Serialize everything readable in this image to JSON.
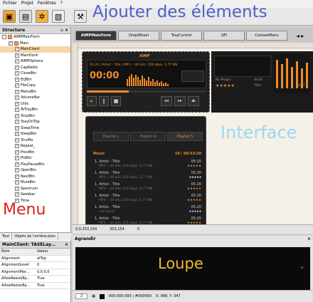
{
  "menubar": {
    "items": [
      "Fichier",
      "Projet",
      "Fenêtres",
      "?"
    ]
  },
  "overlay": {
    "title": "Ajouter des éléments",
    "interface": "Interface",
    "menu": "Menu",
    "loupe": "Loupe"
  },
  "structure": {
    "title": "Structure",
    "items": [
      {
        "label": "AIMPMainForm",
        "indent": 0,
        "checked": false,
        "icon": true
      },
      {
        "label": "Main",
        "indent": 1,
        "checked": true,
        "icon": true
      },
      {
        "label": "MainClient",
        "indent": 2,
        "checked": true,
        "selected": true
      },
      {
        "label": "MainDock",
        "indent": 2,
        "checked": true
      },
      {
        "label": "AIMPOptions",
        "indent": 2,
        "checked": true
      },
      {
        "label": "CapRadio",
        "indent": 2,
        "checked": true
      },
      {
        "label": "CloseBtn",
        "indent": 2,
        "checked": true
      },
      {
        "label": "EQBtn",
        "indent": 2,
        "checked": true
      },
      {
        "label": "FileCopy",
        "indent": 2,
        "checked": true
      },
      {
        "label": "MenuBtn",
        "indent": 2,
        "checked": true
      },
      {
        "label": "VolumeBar",
        "indent": 2,
        "checked": true
      },
      {
        "label": "Utils",
        "indent": 2,
        "checked": true
      },
      {
        "label": "ToTrayBtn",
        "indent": 2,
        "checked": true
      },
      {
        "label": "StopBtn",
        "indent": 2,
        "checked": true
      },
      {
        "label": "StayOnTop",
        "indent": 2,
        "checked": true
      },
      {
        "label": "SleepTime",
        "indent": 2,
        "checked": true
      },
      {
        "label": "SleepBtn",
        "indent": 2,
        "checked": true
      },
      {
        "label": "Shuffle",
        "indent": 2,
        "checked": true
      },
      {
        "label": "Repeat_",
        "indent": 2,
        "checked": true
      },
      {
        "label": "PrevBtn",
        "indent": 2,
        "checked": true
      },
      {
        "label": "PlsBtn",
        "indent": 2,
        "checked": true
      },
      {
        "label": "PlayPauseBtn",
        "indent": 2,
        "checked": true
      },
      {
        "label": "OpenBtn",
        "indent": 2,
        "checked": true
      },
      {
        "label": "NextBtn",
        "indent": 2,
        "checked": true
      },
      {
        "label": "MuteBtn",
        "indent": 2,
        "checked": true
      },
      {
        "label": "Spectrum",
        "indent": 2,
        "checked": true
      },
      {
        "label": "Seekbar",
        "indent": 2,
        "checked": true
      },
      {
        "label": "Time",
        "indent": 2,
        "checked": true
      }
    ],
    "tabs": [
      "Tout",
      "Objets de l'arrière-plan"
    ]
  },
  "props": {
    "title": "MainClient: TASELay...",
    "headers": [
      "Nom",
      "Valeur"
    ],
    "rows": [
      {
        "name": "Alignment",
        "value": "alTop"
      },
      {
        "name": "AlignmentLevel",
        "value": "0"
      },
      {
        "name": "AlignmentMar...",
        "value": "0,0,0,0"
      },
      {
        "name": "AllowResizeBy...",
        "value": "True"
      },
      {
        "name": "AllowResizeBy...",
        "value": "True"
      }
    ]
  },
  "formtabs": [
    "AIMPMainForm",
    "DropWheel",
    "TrayControl",
    "QFI",
    "ContextMenu"
  ],
  "player": {
    "title": "AIMP",
    "info": "05:20 | Artist - Title | MP3 :: 44 kHz, 256 kbps, 5,77 Mb",
    "time": "00:00",
    "rating_label": "Title",
    "pl_info": "No Plugin",
    "artist": "Artist",
    "year": "2007"
  },
  "playlist": {
    "tabs": [
      "Playlist 1",
      "Playlist 4",
      "Playlist 5"
    ],
    "group": "Music",
    "group_info": "10 / 00:53:20",
    "tracks": [
      {
        "title": "1. Artist - Title",
        "time": "05:20",
        "sub": "MP3 :: 44 kHz, 256 kbps, 5,77 Mb"
      },
      {
        "title": "1. Artist - Title",
        "time": "05:20",
        "sub": "MP3 :: 44 kHz, 256 kbps, 5,77 Mb"
      },
      {
        "title": "1. Artist - Title",
        "time": "05:20",
        "sub": "MP3 :: 44 kHz, 256 kbps, 5,77 Mb"
      },
      {
        "title": "1. Artist - Title",
        "time": "05:20",
        "sub": "MP3 :: 44 kHz, 256 kbps, 5,77 Mb"
      },
      {
        "title": "1. Artist - Title",
        "time": "05:20",
        "sub": "not found"
      },
      {
        "title": "1. Artist - Title",
        "time": "05:20",
        "sub": "MP3 :: 44 kHz, 256 kbps, 5,77 Mb"
      }
    ]
  },
  "statusbar": {
    "pos": "0,0,353,154",
    "size": "353,154",
    "count": "0"
  },
  "agrandir": {
    "title": "Agrandir"
  },
  "bottombar": {
    "zoom": "2",
    "color": "000.000.000 | #000000",
    "coords": "X: 999, Y: 347"
  },
  "colors": {
    "accent": "#f08a2a",
    "title_overlay": "#4d5fc7",
    "interface": "#9ed8f0",
    "menu": "#d72020",
    "loupe": "#f2b92c"
  }
}
